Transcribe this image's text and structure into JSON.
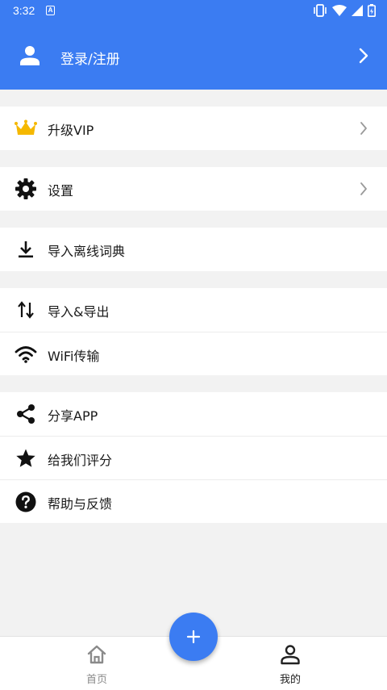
{
  "status_bar": {
    "time": "3:32",
    "app_badge": "A"
  },
  "header": {
    "login_label": "登录/注册",
    "background": "#3b7cf2"
  },
  "menu": {
    "vip": "升级VIP",
    "settings": "设置",
    "import_dict": "导入离线词典",
    "import_export": "导入&导出",
    "wifi_transfer": "WiFi传输",
    "share_app": "分享APP",
    "rate_us": "给我们评分",
    "help_feedback": "帮助与反馈"
  },
  "icons": {
    "vip": "crown-icon",
    "settings": "gear-icon",
    "import_dict": "download-icon",
    "import_export": "swap-vertical-icon",
    "wifi_transfer": "wifi-icon",
    "share_app": "share-icon",
    "rate_us": "star-icon",
    "help_feedback": "help-circle-icon"
  },
  "bottom_nav": {
    "home": "首页",
    "mine": "我的",
    "active": "mine"
  },
  "colors": {
    "accent": "#3b7cf2",
    "crown": "#f5b800",
    "background": "#f2f2f2"
  }
}
